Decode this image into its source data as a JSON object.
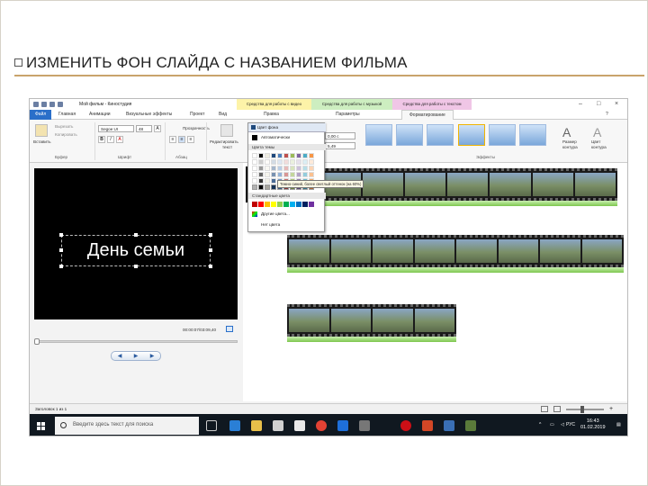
{
  "slide": {
    "heading": "ИЗМЕНИТЬ ФОН СЛАЙДА С НАЗВАНИЕМ ФИЛЬМА"
  },
  "window": {
    "title": "Мой фильм - Киностудия",
    "context_tabs": {
      "video_tools": "Средства для работы с видео",
      "music_tools": "Средства для работы с музыкой",
      "text_tools": "Средства для работы с текстом"
    },
    "colors": {
      "video_tools_tab": "#fdf3a8",
      "music_tools_tab": "#cdeec0",
      "text_tools_tab": "#f0c6e6",
      "file_tab": "#2a6fc9"
    }
  },
  "ribbon": {
    "tabs": {
      "file": "Файл",
      "home": "Главная",
      "animations": "Анимации",
      "visual_effects": "Визуальные эффекты",
      "project": "Проект",
      "view": "Вид",
      "edit": "Правка",
      "options": "Параметры",
      "format": "Форматирование"
    },
    "clipboard": {
      "paste": "Вставить",
      "cut": "Вырезать",
      "copy": "Копировать",
      "group": "Буфер"
    },
    "font": {
      "family": "Segoe UI",
      "size": "48",
      "group": "Шрифт"
    },
    "paragraph": {
      "transparency": "Прозрачность",
      "group": "Абзац"
    },
    "edit_text": {
      "line1": "Редактировать",
      "line2": "текст"
    },
    "bg_color_button": "Цвет фона",
    "start_time": "0,00 с",
    "duration": "5,49",
    "effects_group": "Эффекты",
    "outline_size": {
      "line1": "Размер",
      "line2": "контура"
    },
    "outline_color": {
      "line1": "Цвет",
      "line2": "контура"
    }
  },
  "color_dropdown": {
    "automatic": "Автоматически",
    "theme_colors": "Цвета темы",
    "standard_colors": "Стандартные цвета",
    "more_colors": "Другие цвета...",
    "no_color": "Нет цвета",
    "theme_palette": [
      "#ffffff",
      "#000000",
      "#eeece1",
      "#1f497d",
      "#4f81bd",
      "#c0504d",
      "#9bbb59",
      "#8064a2",
      "#4bacc6",
      "#f79646"
    ],
    "standard_palette": [
      "#c00000",
      "#ff0000",
      "#ffc000",
      "#ffff00",
      "#92d050",
      "#00b050",
      "#00b0f0",
      "#0070c0",
      "#002060",
      "#7030a0"
    ]
  },
  "tooltip": "Темно-синий, более светлый оттенок (на 60%)",
  "preview": {
    "title_text": "День семьи",
    "timecode": "00:00:07/03:09,40"
  },
  "status": {
    "text": "Заголовок 1 из 1"
  },
  "taskbar": {
    "search_placeholder": "Введите здесь текст для поиска",
    "lang": "РУС",
    "time": "16:43",
    "date": "01.02.2019"
  }
}
